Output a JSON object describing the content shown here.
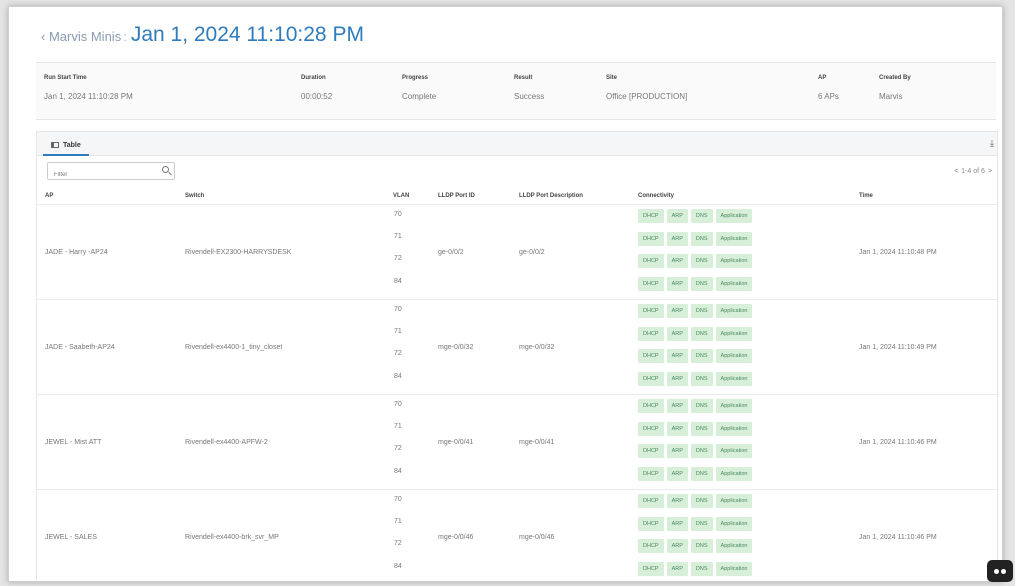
{
  "header": {
    "back_label": "Marvis Minis",
    "separator": ":",
    "title": "Jan 1, 2024 11:10:28 PM"
  },
  "run_info": [
    {
      "label": "Run Start Time",
      "value": "Jan 1, 2024 11:10:28 PM"
    },
    {
      "label": "Duration",
      "value": "00:00:52"
    },
    {
      "label": "Progress",
      "value": "Complete"
    },
    {
      "label": "Result",
      "value": "Success"
    },
    {
      "label": "Site",
      "value": "Office [PRODUCTION]"
    },
    {
      "label": "AP",
      "value": "6 APs"
    },
    {
      "label": "Created By",
      "value": "Marvis"
    }
  ],
  "tabs": [
    {
      "label": "Table"
    }
  ],
  "filter": {
    "placeholder": "Filter"
  },
  "pagination": {
    "prev": "<",
    "label": "1-4 of 6",
    "next": ">"
  },
  "columns": [
    "AP",
    "Switch",
    "VLAN",
    "LLDP Port ID",
    "LLDP Port Description",
    "Connectivity",
    "Time"
  ],
  "connectivity_tags": [
    "DHCP",
    "ARP",
    "DNS",
    "Application"
  ],
  "rows": [
    {
      "ap": "JADE - Harry -AP24",
      "switch": "Rivendell-EX2300-HARRYSDESK",
      "vlans": [
        "70",
        "71",
        "72",
        "84"
      ],
      "lldp_port_id": "ge-0/0/2",
      "lldp_port_desc": "ge-0/0/2",
      "time": "Jan 1, 2024 11:10:48 PM"
    },
    {
      "ap": "JADE - Saabeth-AP24",
      "switch": "Rivendell-ex4400-1_tiny_closet",
      "vlans": [
        "70",
        "71",
        "72",
        "84"
      ],
      "lldp_port_id": "mge-0/0/32",
      "lldp_port_desc": "mge-0/0/32",
      "time": "Jan 1, 2024 11:10:49 PM"
    },
    {
      "ap": "JEWEL - Mist ATT",
      "switch": "Rivendell-ex4400-APFW-2",
      "vlans": [
        "70",
        "71",
        "72",
        "84"
      ],
      "lldp_port_id": "mge-0/0/41",
      "lldp_port_desc": "mge-0/0/41",
      "time": "Jan 1, 2024 11:10:46 PM"
    },
    {
      "ap": "JEWEL - SALES",
      "switch": "Rivendell-ex4400-brk_svr_MP",
      "vlans": [
        "70",
        "71",
        "72",
        "84"
      ],
      "lldp_port_id": "mge-0/0/46",
      "lldp_port_desc": "mge-0/0/46",
      "time": "Jan 1, 2024 11:10:46 PM"
    }
  ],
  "colors": {
    "accent": "#2e7bbd",
    "tag_bg": "#d7efd9",
    "tag_text": "#4a8a5a"
  },
  "icons": [
    "chevron-left-icon",
    "table-icon",
    "download-icon",
    "search-icon",
    "chat-bot-icon"
  ]
}
